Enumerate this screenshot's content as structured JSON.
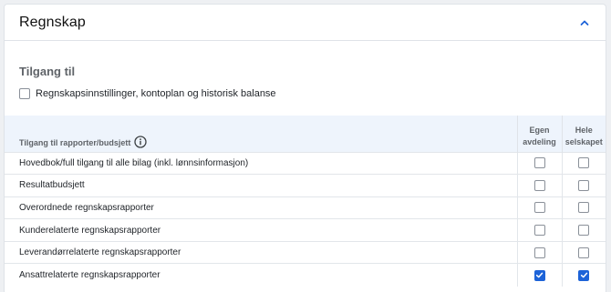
{
  "header": {
    "title": "Regnskap",
    "collapse_icon": "chevron-up-icon"
  },
  "access": {
    "title": "Tilgang til",
    "option": {
      "label": "Regnskapsinnstillinger, kontoplan og historisk balanse",
      "checked": false
    }
  },
  "table": {
    "header_label": "Tilgang til rapporter/budsjett",
    "info_icon": "info-icon",
    "col1": {
      "line1": "Egen",
      "line2": "avdeling"
    },
    "col2": {
      "line1": "Hele",
      "line2": "selskapet"
    },
    "rows": [
      {
        "label": "Hovedbok/full tilgang til alle bilag (inkl. lønnsinformasjon)",
        "egen": false,
        "hele": false
      },
      {
        "label": "Resultatbudsjett",
        "egen": false,
        "hele": false
      },
      {
        "label": "Overordnede regnskapsrapporter",
        "egen": false,
        "hele": false
      },
      {
        "label": "Kunderelaterte regnskapsrapporter",
        "egen": false,
        "hele": false
      },
      {
        "label": "Leverandørrelaterte regnskapsrapporter",
        "egen": false,
        "hele": false
      },
      {
        "label": "Ansattrelaterte regnskapsrapporter",
        "egen": true,
        "hele": true
      }
    ]
  },
  "colors": {
    "accent": "#1d63d8",
    "header_bg": "#eef4fc"
  }
}
